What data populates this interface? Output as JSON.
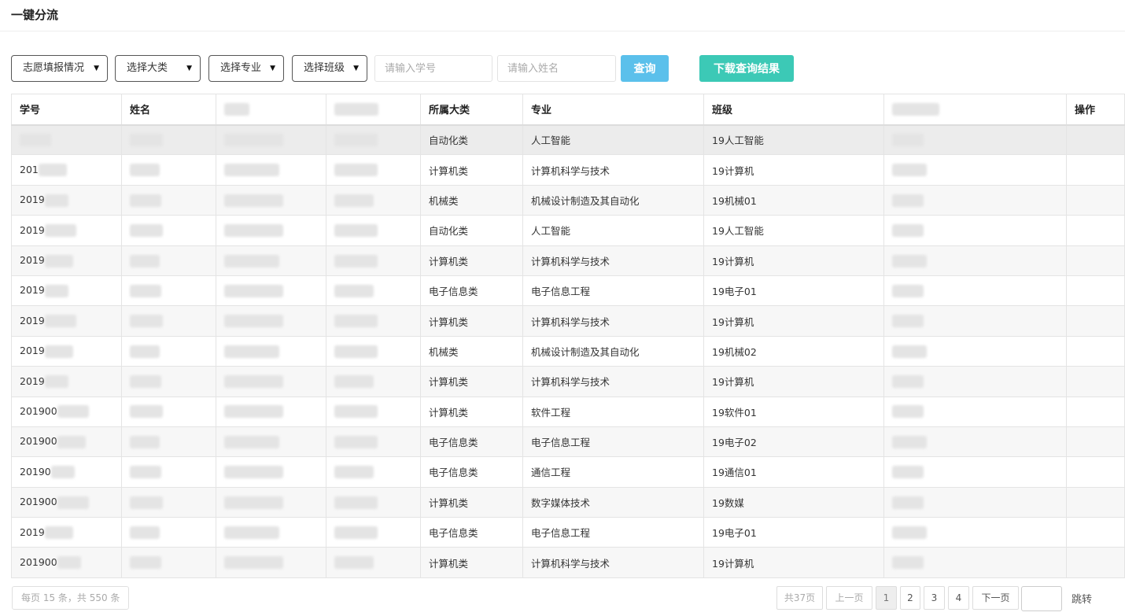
{
  "page": {
    "title": "一键分流"
  },
  "filters": {
    "volunteer_status": "志愿填报情况",
    "category": "选择大类",
    "major": "选择专业",
    "class": "选择班级",
    "student_id_placeholder": "请输入学号",
    "name_placeholder": "请输入姓名",
    "query_label": "查询",
    "download_label": "下载查询结果"
  },
  "table": {
    "headers": [
      "学号",
      "姓名",
      "",
      "",
      "所属大类",
      "专业",
      "班级",
      "",
      "操作"
    ],
    "rows": [
      {
        "id": "",
        "category": "自动化类",
        "major": "人工智能",
        "class": "19人工智能"
      },
      {
        "id": "201",
        "category": "计算机类",
        "major": "计算机科学与技术",
        "class": "19计算机"
      },
      {
        "id": "2019",
        "category": "机械类",
        "major": "机械设计制造及其自动化",
        "class": "19机械01"
      },
      {
        "id": "2019",
        "category": "自动化类",
        "major": "人工智能",
        "class": "19人工智能"
      },
      {
        "id": "2019",
        "category": "计算机类",
        "major": "计算机科学与技术",
        "class": "19计算机"
      },
      {
        "id": "2019",
        "category": "电子信息类",
        "major": "电子信息工程",
        "class": "19电子01"
      },
      {
        "id": "2019",
        "category": "计算机类",
        "major": "计算机科学与技术",
        "class": "19计算机"
      },
      {
        "id": "2019",
        "category": "机械类",
        "major": "机械设计制造及其自动化",
        "class": "19机械02"
      },
      {
        "id": "2019",
        "category": "计算机类",
        "major": "计算机科学与技术",
        "class": "19计算机"
      },
      {
        "id": "201900",
        "category": "计算机类",
        "major": "软件工程",
        "class": "19软件01"
      },
      {
        "id": "201900",
        "category": "电子信息类",
        "major": "电子信息工程",
        "class": "19电子02"
      },
      {
        "id": "20190",
        "category": "电子信息类",
        "major": "通信工程",
        "class": "19通信01"
      },
      {
        "id": "201900",
        "category": "计算机类",
        "major": "数字媒体技术",
        "class": "19数媒"
      },
      {
        "id": "2019",
        "category": "电子信息类",
        "major": "电子信息工程",
        "class": "19电子01"
      },
      {
        "id": "201900",
        "category": "计算机类",
        "major": "计算机科学与技术",
        "class": "19计算机"
      }
    ]
  },
  "pagination": {
    "info": "每页 15 条，共 550 条",
    "total_pages": "共37页",
    "prev": "上一页",
    "pages": [
      "1",
      "2",
      "3",
      "4"
    ],
    "next": "下一页",
    "jump": "跳转"
  }
}
